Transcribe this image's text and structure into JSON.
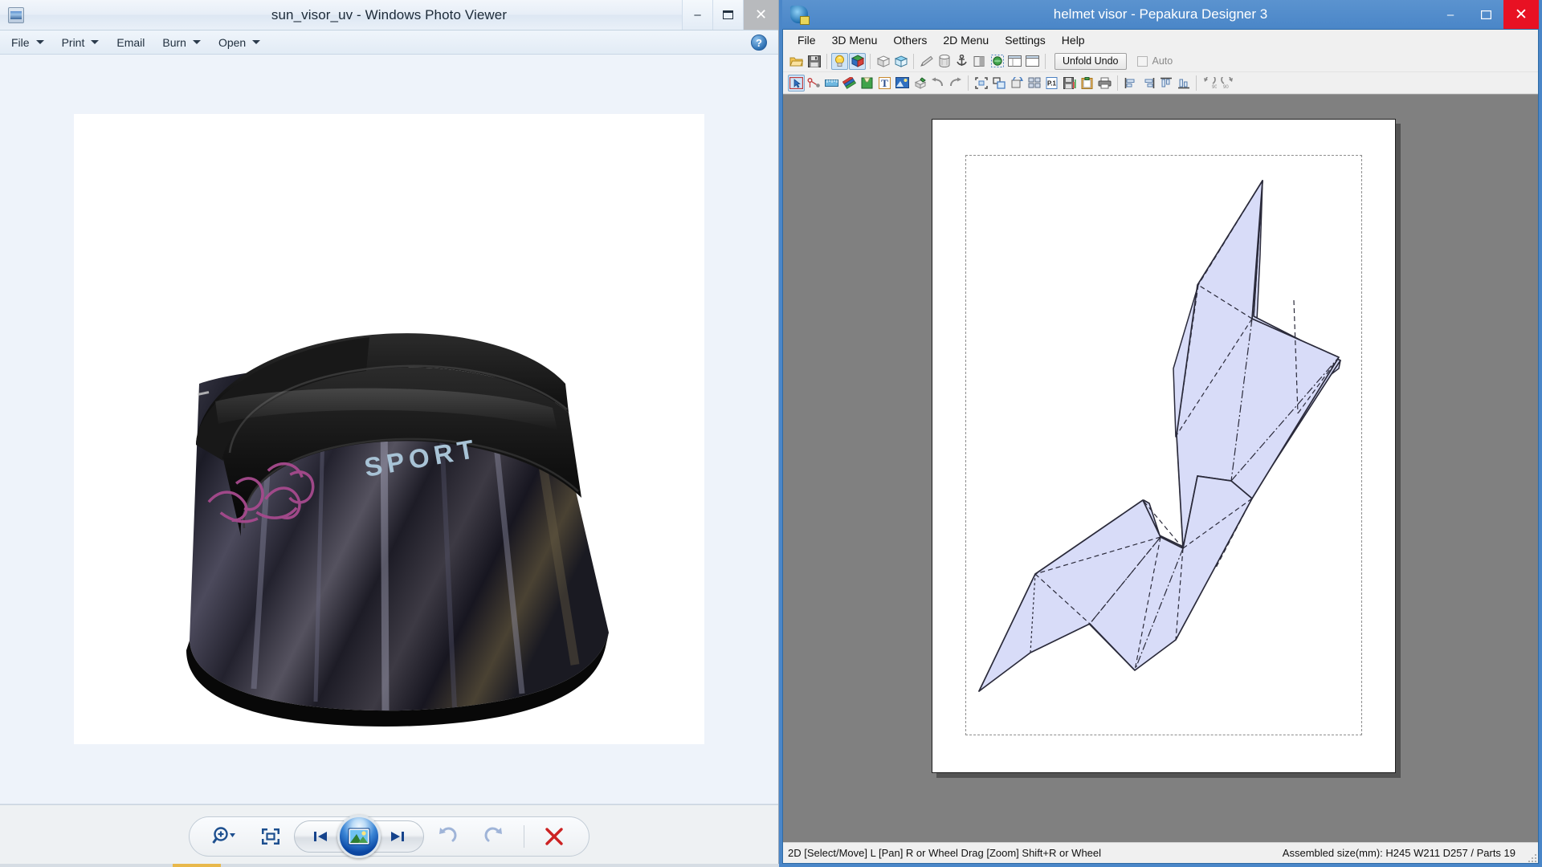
{
  "photo_viewer": {
    "title": "sun_visor_uv - Windows Photo Viewer",
    "app_icon": "photo-viewer-icon",
    "window_buttons": {
      "minimize": "–",
      "maximize": "❐",
      "close": "✕"
    },
    "menu": [
      {
        "label": "File",
        "has_caret": true
      },
      {
        "label": "Print",
        "has_caret": true
      },
      {
        "label": "Email",
        "has_caret": false
      },
      {
        "label": "Burn",
        "has_caret": true
      },
      {
        "label": "Open",
        "has_caret": true
      }
    ],
    "help_button": "?",
    "image": {
      "name": "sun-visor-photograph",
      "brand_text": "SPORT",
      "background": "#ffffff"
    },
    "bottom_toolbar": [
      {
        "name": "zoom-control",
        "icon": "magnifier-plus-icon",
        "has_caret": true
      },
      {
        "name": "actual-size-button",
        "icon": "fit-to-window-icon",
        "has_caret": false
      },
      {
        "name": "previous-button",
        "icon": "skip-previous-icon",
        "has_caret": false
      },
      {
        "name": "slideshow-button",
        "icon": "play-slideshow-icon",
        "has_caret": false
      },
      {
        "name": "next-button",
        "icon": "skip-next-icon",
        "has_caret": false
      },
      {
        "name": "rotate-counterclockwise-button",
        "icon": "rotate-ccw-icon",
        "has_caret": false
      },
      {
        "name": "rotate-clockwise-button",
        "icon": "rotate-cw-icon",
        "has_caret": false
      },
      {
        "name": "delete-button",
        "icon": "delete-x-icon",
        "has_caret": false
      }
    ]
  },
  "pepakura": {
    "title": "helmet visor - Pepakura Designer 3",
    "app_icon": "pepakura-icon",
    "window_buttons": {
      "minimize": "–",
      "maximize": "❐",
      "close": "✕"
    },
    "menu": [
      "File",
      "3D Menu",
      "Others",
      "2D Menu",
      "Settings",
      "Help"
    ],
    "toolbar_row1": [
      {
        "name": "open-file-button",
        "icon": "open-folder-icon",
        "active": false
      },
      {
        "name": "save-file-button",
        "icon": "floppy-save-icon",
        "active": false
      },
      {
        "sep": true
      },
      {
        "name": "show-light-button",
        "icon": "lightbulb-icon",
        "active": true
      },
      {
        "name": "show-texture-button",
        "icon": "colored-cube-icon",
        "active": true
      },
      {
        "sep": true
      },
      {
        "name": "flat-shading-button",
        "icon": "white-cube-icon",
        "active": false
      },
      {
        "name": "smooth-shading-button",
        "icon": "blue-cube-icon",
        "active": false
      },
      {
        "sep": true
      },
      {
        "name": "edit-edge-button",
        "icon": "pencil-eraser-icon",
        "active": false
      },
      {
        "name": "cylinder-tool-button",
        "icon": "cylinder-icon",
        "active": false
      },
      {
        "name": "anchor-tool-button",
        "icon": "anchor-icon",
        "active": false
      },
      {
        "name": "split-face-button",
        "icon": "split-face-icon",
        "active": false
      },
      {
        "name": "select-region-button",
        "icon": "dashed-globe-icon",
        "active": false
      },
      {
        "name": "open-window-button",
        "icon": "window-icon",
        "active": false
      },
      {
        "name": "second-window-button",
        "icon": "window-2-icon",
        "active": false
      },
      {
        "sep": true
      },
      {
        "name": "unfold-undo-button",
        "label": "Unfold Undo",
        "type": "button"
      },
      {
        "name": "auto-checkbox",
        "label": "Auto",
        "type": "checkbox",
        "checked": false
      }
    ],
    "toolbar_row2": [
      {
        "name": "select-move-tool",
        "icon": "select-arrow-icon",
        "active": true
      },
      {
        "name": "join-disjoin-tool",
        "icon": "join-nodes-icon",
        "active": false
      },
      {
        "name": "measure-tool",
        "icon": "ruler-icon",
        "active": false
      },
      {
        "name": "paint-flaps-tool",
        "icon": "colored-pencils-icon",
        "active": false
      },
      {
        "name": "add-flap-tool",
        "icon": "flap-icon",
        "active": false
      },
      {
        "name": "text-tool",
        "icon": "text-T-icon",
        "active": false
      },
      {
        "name": "image-tool",
        "icon": "picture-icon",
        "active": false
      },
      {
        "name": "texture-paint-tool",
        "icon": "paint-cube-icon",
        "active": false
      },
      {
        "name": "undo-button",
        "icon": "undo-arrow-icon",
        "active": false
      },
      {
        "name": "redo-button",
        "icon": "redo-arrow-icon",
        "active": false
      },
      {
        "sep": true
      },
      {
        "name": "fit-page-button",
        "icon": "fit-frame-icon",
        "active": false
      },
      {
        "name": "scale-button",
        "icon": "scale-icon",
        "active": false
      },
      {
        "name": "rotate-parts-button",
        "icon": "rotate-parts-icon",
        "active": false
      },
      {
        "name": "layout-parts-button",
        "icon": "layout-grid-icon",
        "active": false
      },
      {
        "name": "page-setup-button",
        "icon": "page-p1-icon",
        "active": false
      },
      {
        "name": "export-button",
        "icon": "save-export-icon",
        "active": false
      },
      {
        "name": "clipboard-button",
        "icon": "clipboard-icon",
        "active": false
      },
      {
        "name": "print-button",
        "icon": "printer-icon",
        "active": false
      },
      {
        "sep": true
      },
      {
        "name": "align-left-button",
        "icon": "align-left-icon",
        "active": false
      },
      {
        "name": "align-right-button",
        "icon": "align-right-icon",
        "active": false
      },
      {
        "name": "align-top-button",
        "icon": "align-top-icon",
        "active": false
      },
      {
        "name": "align-bottom-button",
        "icon": "align-bottom-icon",
        "active": false
      },
      {
        "sep": true
      },
      {
        "name": "rotate-90-ccw-button",
        "icon": "rotate-90-ccw-icon",
        "active": false
      },
      {
        "name": "rotate-90-cw-button",
        "icon": "rotate-90-cw-icon",
        "active": false
      }
    ],
    "unfold_undo_label": "Unfold Undo",
    "auto_label": "Auto",
    "status_left": "2D [Select/Move] L [Pan] R or Wheel Drag [Zoom] Shift+R or Wheel",
    "status_right": "Assembled size(mm): H245 W211 D257 / Parts 19",
    "canvas": {
      "background": "#808080",
      "paper_background": "#ffffff",
      "part_fill": "#d8dcf8",
      "part_stroke": "#2a2a3a",
      "fold_line_style": "dashed",
      "margin_guide_style": "dashed"
    }
  }
}
